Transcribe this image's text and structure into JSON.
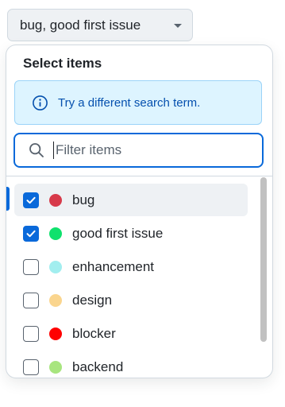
{
  "trigger": {
    "label": "bug, good first issue",
    "icon": "triangle-down-icon"
  },
  "overlay": {
    "title": "Select items",
    "notice": {
      "icon": "info-icon",
      "text": "Try a different search term.",
      "color": "#0550ae",
      "background": "#ddf4ff"
    },
    "filter": {
      "icon": "search-icon",
      "value": "",
      "placeholder": "Filter items"
    },
    "items": [
      {
        "label": "bug",
        "checked": true,
        "color": "#d73a4a",
        "active": true
      },
      {
        "label": "good first issue",
        "checked": true,
        "color": "#0fe16d",
        "active": false
      },
      {
        "label": "enhancement",
        "checked": false,
        "color": "#a2eeef",
        "active": false
      },
      {
        "label": "design",
        "checked": false,
        "color": "#fad58e",
        "active": false
      },
      {
        "label": "blocker",
        "checked": false,
        "color": "#ff0000",
        "active": false
      },
      {
        "label": "backend",
        "checked": false,
        "color": "#a8e57f",
        "active": false
      }
    ],
    "scroll_fraction_visible": 0.83
  },
  "colors": {
    "accent": "#0969da"
  }
}
